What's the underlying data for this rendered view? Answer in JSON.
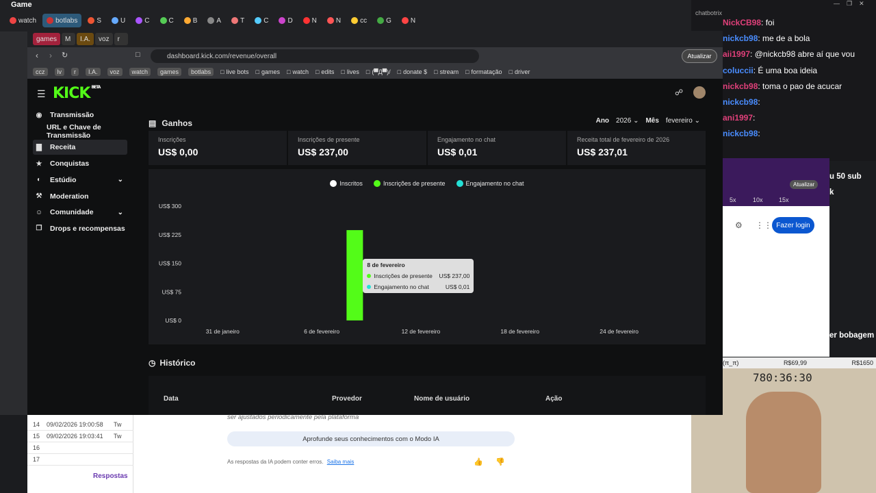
{
  "outer": {
    "title": "Game",
    "tabs": [
      "watch",
      "botlabs",
      "S",
      "U",
      "C",
      "C",
      "B",
      "A",
      "T",
      "C",
      "D",
      "N",
      "N",
      "cc",
      "G",
      "N"
    ]
  },
  "browser": {
    "tabs": [
      "games",
      "M",
      "I.A.",
      "voz",
      "r"
    ],
    "url": "dashboard.kick.com/revenue/overall",
    "update_label": "Atualizar",
    "bookmarks": [
      "ccz",
      "lv",
      "r",
      "I.A.",
      "voz",
      "watch",
      "games",
      "botlabs",
      "live bots",
      "games",
      "watch",
      "edits",
      "lives",
      "(▀Д▀)/",
      "donate $",
      "stream",
      "formatação",
      "driver"
    ]
  },
  "kick": {
    "logo": "KICK",
    "logo_beta": "BETA",
    "sidebar": [
      {
        "label": "Transmissão",
        "icon": "broadcast-icon"
      },
      {
        "label": "URL e Chave de Transmissão",
        "icon": ""
      },
      {
        "label": "Receita",
        "icon": "chart-icon",
        "active": true
      },
      {
        "label": "Conquistas",
        "icon": "trophy-icon"
      },
      {
        "label": "Estúdio",
        "icon": "palette-icon",
        "chevron": true
      },
      {
        "label": "Moderation",
        "icon": "wrench-icon"
      },
      {
        "label": "Comunidade",
        "icon": "people-icon",
        "chevron": true
      },
      {
        "label": "Drops e recompensas",
        "icon": "gift-icon"
      }
    ],
    "title": "Ganhos",
    "year_label": "Ano",
    "year_value": "2026",
    "month_label": "Mês",
    "month_value": "fevereiro",
    "cards": [
      {
        "label": "Inscrições",
        "value": "US$ 0,00"
      },
      {
        "label": "Inscrições de presente",
        "value": "US$ 237,00"
      },
      {
        "label": "Engajamento no chat",
        "value": "US$ 0,01"
      },
      {
        "label": "Receita total de fevereiro de 2026",
        "value": "US$ 237,01"
      }
    ],
    "history_title": "Histórico",
    "history_headers": [
      "Data",
      "Provedor",
      "Nome de usuário",
      "Ação"
    ]
  },
  "chart_data": {
    "type": "bar",
    "title": "",
    "xlabel": "",
    "ylabel": "",
    "ylim": [
      0,
      300
    ],
    "y_ticks": [
      "US$ 0",
      "US$ 75",
      "US$ 150",
      "US$ 225",
      "US$ 300"
    ],
    "y_tick_values": [
      0,
      75,
      150,
      225,
      300
    ],
    "x_ticks": [
      "31 de janeiro",
      "6 de fevereiro",
      "12 de fevereiro",
      "18 de fevereiro",
      "24 de fevereiro"
    ],
    "x_tick_days": [
      0,
      6,
      12,
      18,
      24
    ],
    "legend": [
      "Inscritos",
      "Inscrições de presente",
      "Engajamento no chat"
    ],
    "legend_colors": [
      "#ffffff",
      "#53fc18",
      "#24e0d6"
    ],
    "bars": [
      {
        "day_label": "8 de fevereiro",
        "day": 8,
        "series": "Inscrições de presente",
        "value": 237.0
      }
    ],
    "tooltip": {
      "title": "8 de fevereiro",
      "rows": [
        {
          "label": "Inscrições de presente",
          "value": "US$ 237,00",
          "color": "#53fc18"
        },
        {
          "label": "Engajamento no chat",
          "value": "US$ 0,01",
          "color": "#24e0d6"
        }
      ]
    },
    "x_range_days": [
      -2,
      27
    ]
  },
  "chat": {
    "label": "chatbotrix",
    "lines": [
      {
        "user": "NickCB98",
        "text": ": foi"
      },
      {
        "user": "nickcb98",
        "text": ": me de a bola"
      },
      {
        "user": "aii1997",
        "text": ": @nickcb98 abre aí que vou"
      },
      {
        "user": "coluccii",
        "text": ": É uma boa ideia"
      },
      {
        "user": "nickcb98",
        "text": ": toma o pao de acucar"
      },
      {
        "user": "nickcb98",
        "text": ":"
      },
      {
        "user": "ani1997",
        "text": ":"
      },
      {
        "user": "nickcb98",
        "text": ":"
      }
    ],
    "partial": [
      "u 50 sub",
      "k",
      "er bobagem"
    ]
  },
  "popup": {
    "update_label": "Atualizar",
    "zoom": [
      "5x",
      "10x",
      "15x"
    ],
    "login": "Fazer login"
  },
  "cam": {
    "title_left": "fev/março (π_π)",
    "title_mid": "R$69,99",
    "title_right": "R$1650",
    "timer": "780:36:30"
  },
  "bottom": {
    "rows": [
      {
        "n": "14",
        "date": "09/02/2026 19:00:58",
        "x": "Tw"
      },
      {
        "n": "15",
        "date": "09/02/2026 19:03:41",
        "x": "Tw"
      },
      {
        "n": "16",
        "date": "",
        "x": ""
      },
      {
        "n": "17",
        "date": "",
        "x": ""
      }
    ],
    "sheet_tab": "Respostas",
    "ai_note": "ser ajustados periodicamente pela plataforma",
    "ai_button": "Aprofunde seus conhecimentos com o Modo IA",
    "ai_disclaimer": "As respostas da IA podem conter erros.",
    "ai_more": "Saiba mais"
  }
}
